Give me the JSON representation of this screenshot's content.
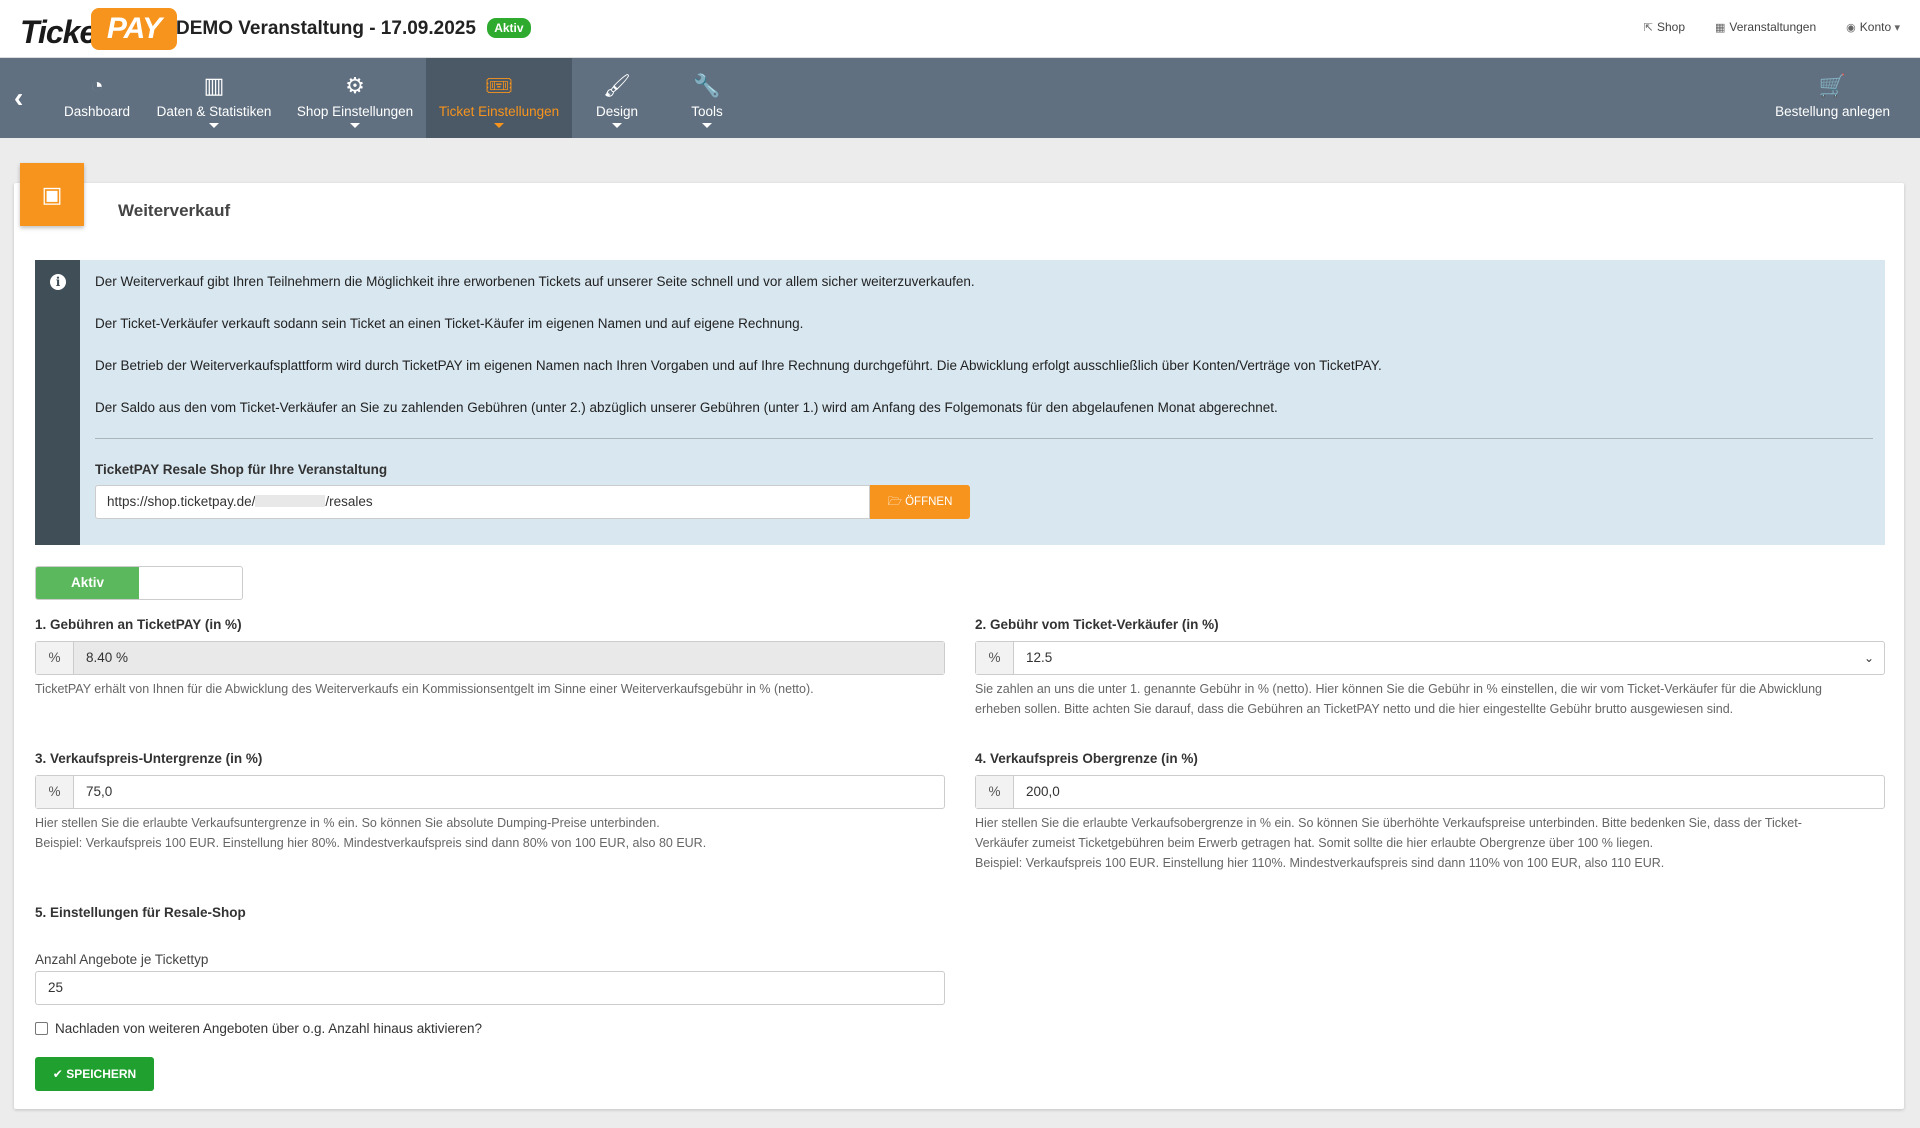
{
  "header": {
    "logo_part1": "Ticket",
    "logo_part2": "PAY",
    "event_title": "DEMO Veranstaltung - 17.09.2025",
    "status_badge": "Aktiv",
    "links": [
      {
        "icon": "external-link-icon",
        "label": "Shop"
      },
      {
        "icon": "calendar-icon",
        "label": "Veranstaltungen"
      },
      {
        "icon": "user-circle-icon",
        "label": "Konto"
      }
    ]
  },
  "nav": {
    "items": [
      {
        "icon": "dashboard-icon",
        "label": "Dashboard"
      },
      {
        "icon": "bar-chart-icon",
        "label": "Daten & Statistiken"
      },
      {
        "icon": "gear-icon",
        "label": "Shop Einstellungen"
      },
      {
        "icon": "ticket-icon",
        "label": "Ticket Einstellungen",
        "active": true
      },
      {
        "icon": "brush-icon",
        "label": "Design"
      },
      {
        "icon": "wrench-icon",
        "label": "Tools"
      }
    ],
    "right": {
      "icon": "cart-icon",
      "label": "Bestellung anlegen"
    }
  },
  "card": {
    "icon": "money-icon",
    "title": "Weiterverkauf"
  },
  "info": {
    "paragraphs": [
      "Der Weiterverkauf gibt Ihren Teilnehmern die Möglichkeit ihre erworbenen Tickets auf unserer Seite schnell und vor allem sicher weiterzuverkaufen.",
      "Der Ticket-Verkäufer verkauft sodann sein Ticket an einen Ticket-Käufer im eigenen Namen und auf eigene Rechnung.",
      "Der Betrieb der Weiterverkaufsplattform wird durch TicketPAY im eigenen Namen nach Ihren Vorgaben und auf Ihre Rechnung durchgeführt. Die Abwicklung erfolgt ausschließlich über Konten/Verträge von TicketPAY.",
      "Der Saldo aus den vom Ticket-Verkäufer an Sie zu zahlenden Gebühren (unter 2.) abzüglich unserer Gebühren (unter 1.) wird am Anfang des Folgemonats für den abgelaufenen Monat abgerechnet."
    ],
    "shop_label": "TicketPAY Resale Shop für Ihre Veranstaltung",
    "url_prefix": "https://shop.ticketpay.de/",
    "url_suffix": "/resales",
    "open_button": "ÖFFNEN"
  },
  "toggle": {
    "label": "Aktiv"
  },
  "fields": {
    "f1": {
      "label": "1. Gebühren an TicketPAY (in %)",
      "addon": "%",
      "value": "8.40 %",
      "help": "TicketPAY erhält von Ihnen für die Abwicklung des Weiterverkaufs ein Kommissionsentgelt im Sinne einer Weiterverkaufsgebühr in % (netto)."
    },
    "f2": {
      "label": "2. Gebühr vom Ticket-Verkäufer (in %)",
      "addon": "%",
      "value": "12.5",
      "help_lines": [
        "Sie zahlen an uns die unter 1. genannte Gebühr in % (netto). Hier können Sie die Gebühr in % einstellen, die wir vom Ticket-Verkäufer für die Abwicklung",
        "erheben sollen. Bitte achten Sie darauf, dass die Gebühren an TicketPAY netto und die hier eingestellte Gebühr brutto ausgewiesen sind."
      ]
    },
    "f3": {
      "label": "3. Verkaufspreis-Untergrenze (in %)",
      "addon": "%",
      "value": "75,0",
      "help_lines": [
        "Hier stellen Sie die erlaubte Verkaufsuntergrenze in % ein. So können Sie absolute Dumping-Preise unterbinden.",
        "Beispiel: Verkaufspreis 100 EUR. Einstellung hier 80%. Mindestverkaufspreis sind dann 80% von 100 EUR, also 80 EUR."
      ]
    },
    "f4": {
      "label": "4. Verkaufspreis Obergrenze (in %)",
      "addon": "%",
      "value": "200,0",
      "help_lines": [
        "Hier stellen Sie die erlaubte Verkaufsobergrenze in % ein. So können Sie überhöhte Verkaufspreise unterbinden. Bitte bedenken Sie, dass der Ticket-",
        "Verkäufer zumeist Ticketgebühren beim Erwerb getragen hat. Somit sollte die hier erlaubte Obergrenze über 100 % liegen.",
        "Beispiel: Verkaufspreis 100 EUR. Einstellung hier 110%. Mindestverkaufspreis sind dann 110% von 100 EUR, also 110 EUR."
      ]
    }
  },
  "section5": {
    "title": "5. Einstellungen für Resale-Shop",
    "offers_label": "Anzahl Angebote je Tickettyp",
    "offers_value": "25",
    "checkbox_label": "Nachladen von weiteren Angeboten über o.g. Anzahl hinaus aktivieren?",
    "save_button": "SPEICHERN"
  }
}
